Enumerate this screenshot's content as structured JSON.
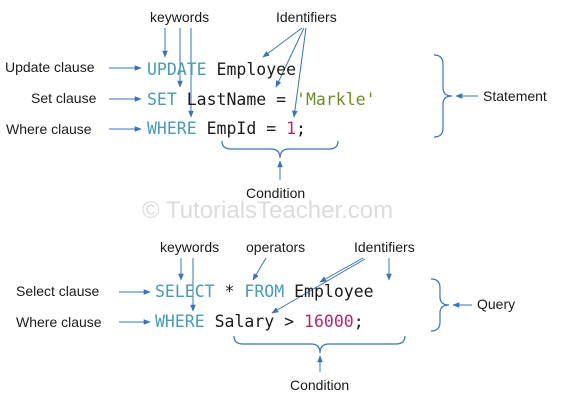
{
  "colors": {
    "keyword": "#4a9ab8",
    "identifier": "#1a1a1a",
    "string": "#6b8e23",
    "number": "#b22a6e",
    "operator": "#1a1a1a",
    "arrow": "#3b73b9",
    "watermark": "#dcdcdc"
  },
  "watermark": "© TutorialsTeacher.com",
  "update_example": {
    "labels": {
      "keywords": "keywords",
      "identifiers": "Identifiers",
      "update_clause": "Update clause",
      "set_clause": "Set clause",
      "where_clause": "Where clause",
      "statement": "Statement",
      "condition": "Condition"
    },
    "line1": {
      "kw": "UPDATE",
      "ident": "Employee"
    },
    "line2": {
      "kw": "SET",
      "ident": "LastName",
      "op": "=",
      "str": "'Markle'"
    },
    "line3": {
      "kw": "WHERE",
      "ident": "EmpId",
      "op": "=",
      "num": "1",
      "end": ";"
    }
  },
  "select_example": {
    "labels": {
      "keywords": "keywords",
      "operators": "operators",
      "identifiers": "Identifiers",
      "select_clause": "Select clause",
      "where_clause": "Where clause",
      "query": "Query",
      "condition": "Condition"
    },
    "line1": {
      "kw": "SELECT",
      "op": "*",
      "kw2": "FROM",
      "ident": "Employee"
    },
    "line2": {
      "kw": "WHERE",
      "ident": "Salary",
      "op": ">",
      "num": "16000",
      "end": ";"
    }
  }
}
